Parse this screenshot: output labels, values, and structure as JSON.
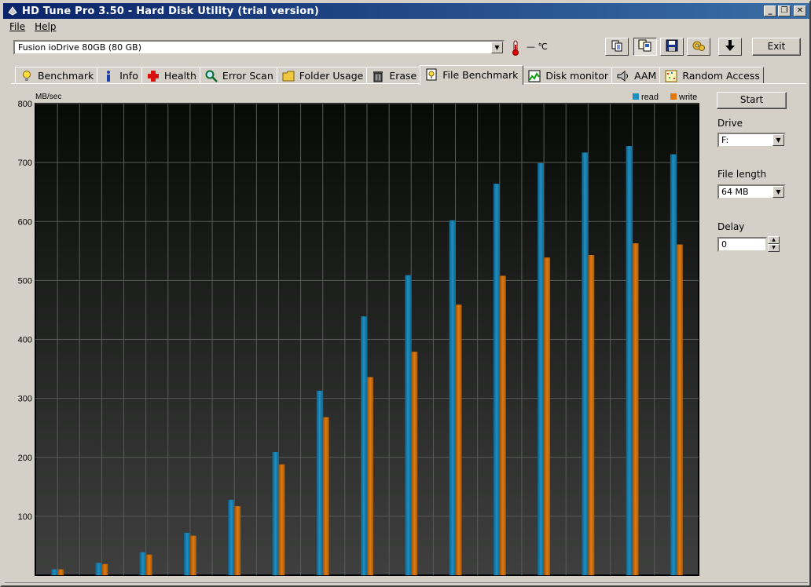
{
  "window": {
    "title": "HD Tune Pro 3.50 - Hard Disk Utility (trial version)",
    "title_buttons": {
      "minimize": "_",
      "restore": "❐",
      "close": "✕"
    }
  },
  "menu": {
    "file": "File",
    "help": "Help"
  },
  "toolbar": {
    "drive": "Fusion ioDrive 80GB  (80 GB)",
    "temperature": "— ℃",
    "icons": [
      "copy-text-icon",
      "copy-screenshot-icon",
      "save-icon",
      "options-icon",
      "download-arrow-icon"
    ],
    "exit_label": "Exit"
  },
  "tabs": [
    {
      "label": "Benchmark",
      "icon": "benchmark-bulb-icon"
    },
    {
      "label": "Info",
      "icon": "info-icon"
    },
    {
      "label": "Health",
      "icon": "health-cross-icon"
    },
    {
      "label": "Error Scan",
      "icon": "magnifier-icon"
    },
    {
      "label": "Folder Usage",
      "icon": "folder-icon"
    },
    {
      "label": "Erase",
      "icon": "trash-icon"
    },
    {
      "label": "File Benchmark",
      "icon": "file-benchmark-icon",
      "active": true
    },
    {
      "label": "Disk monitor",
      "icon": "disk-monitor-icon"
    },
    {
      "label": "AAM",
      "icon": "speaker-icon"
    },
    {
      "label": "Random Access",
      "icon": "random-access-icon"
    }
  ],
  "side_panel": {
    "start_label": "Start",
    "drive_label": "Drive",
    "drive_value": "F:",
    "file_length_label": "File length",
    "file_length_value": "64 MB",
    "delay_label": "Delay",
    "delay_value": "0"
  },
  "colors": {
    "read": "#1e8fc0",
    "write": "#e07a10",
    "plot_bg_top": "#080a08",
    "plot_bg_bottom": "#3e3f3e",
    "grid": "#5a5a5a"
  },
  "chart_data": {
    "type": "bar",
    "ylabel": "MB/sec",
    "ylim": [
      0,
      800
    ],
    "y_ticks": [
      "100",
      "200",
      "300",
      "400",
      "500",
      "600",
      "700",
      "800"
    ],
    "legend_position": "top-right",
    "grid": true,
    "series": [
      {
        "name": "read",
        "values": [
          10,
          21,
          39,
          72,
          128,
          209,
          313,
          439,
          509,
          602,
          664,
          699,
          717,
          728,
          714
        ]
      },
      {
        "name": "write",
        "values": [
          10,
          19,
          35,
          67,
          117,
          188,
          268,
          336,
          379,
          459,
          508,
          539,
          543,
          563,
          561
        ]
      }
    ]
  }
}
